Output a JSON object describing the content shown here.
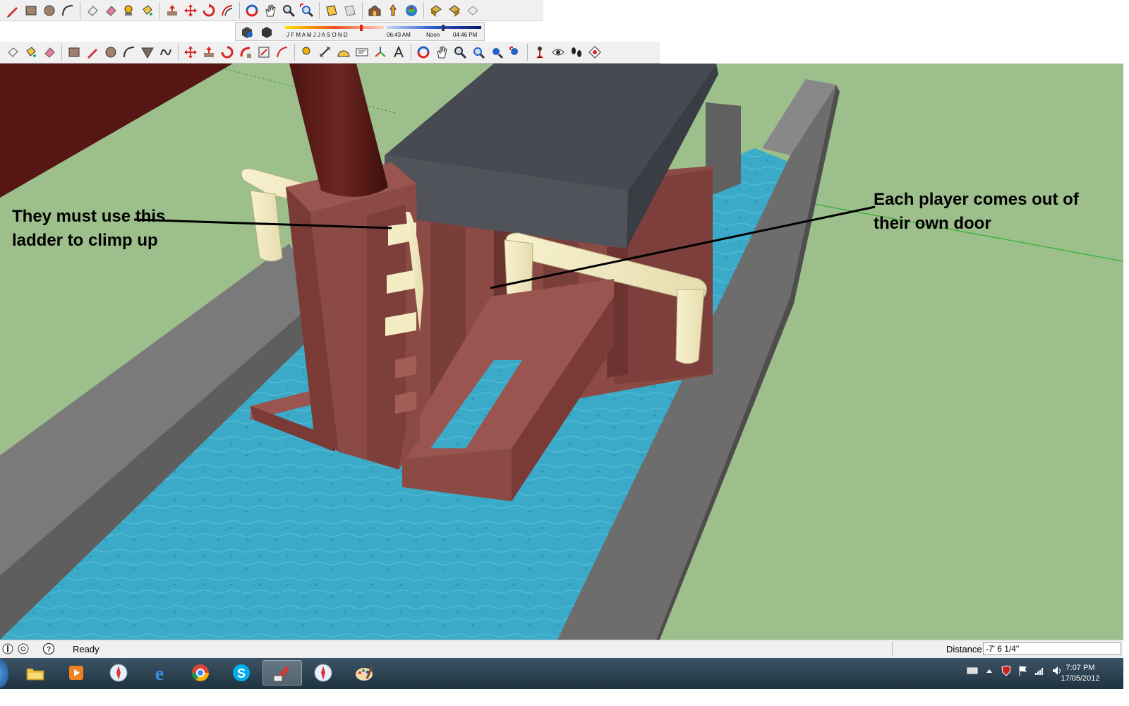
{
  "app": {
    "name": "Google SketchUp"
  },
  "toolbar_top": {
    "icons": [
      "select-pencil-icon",
      "rectangle-icon",
      "circle-icon",
      "arc-icon",
      "eraser-outline-icon",
      "eraser-icon",
      "paint-bucket-icon",
      "push-pull-icon",
      "move-icon",
      "rotate-icon",
      "offset-icon",
      "orbit-icon",
      "pan-icon",
      "zoom-icon",
      "zoom-extents-icon",
      "previous-view-icon",
      "next-view-icon",
      "warehouse-icon",
      "components-icon",
      "share-model-icon",
      "upload-icon",
      "download-icon",
      "extension-icon"
    ]
  },
  "shadow_settings": {
    "months": "J F M A M J J A S O N D",
    "time_start": "06:43 AM",
    "time_mid": "Noon",
    "time_end": "04:46 PM"
  },
  "toolbar_large": {
    "icons": [
      "select-icon",
      "paint-icon",
      "eraser-icon",
      "rectangle-icon",
      "line-icon",
      "circle-icon",
      "arc-icon",
      "polygon-icon",
      "freehand-icon",
      "move-icon",
      "push-pull-icon",
      "rotate-icon",
      "follow-me-icon",
      "scale-icon",
      "offset-icon",
      "tape-icon",
      "dimension-icon",
      "protractor-icon",
      "text-icon",
      "axes-icon",
      "3d-text-icon",
      "orbit-icon",
      "pan-icon",
      "zoom-icon",
      "zoom-window-icon",
      "zoom-extents-icon",
      "previous-icon",
      "position-camera-icon",
      "look-around-icon",
      "walk-icon",
      "section-plane-icon"
    ]
  },
  "annotations": {
    "ladder_line1": "They must use this",
    "ladder_line2": "ladder to climp up",
    "door_line1": "Each player comes out of",
    "door_line2": "their own door"
  },
  "status": {
    "text": "Ready",
    "distance_label": "Distance",
    "distance_value": "-7' 6 1/4\""
  },
  "taskbar": {
    "apps": [
      "windows-explorer-icon",
      "media-player-icon",
      "safari-icon",
      "internet-explorer-icon",
      "chrome-icon",
      "skype-icon",
      "sketchup-icon",
      "safari-icon",
      "paint-icon"
    ],
    "active_index": 6,
    "time": "7:07 PM",
    "date": "17/05/2012"
  },
  "colors": {
    "ground": "#9dbf8c",
    "water": "#3aaac8",
    "wall": "#656565",
    "building": "#8c4a45",
    "roof": "#474a52",
    "pipe": "#f4edc3",
    "chimney": "#5a1a16"
  }
}
